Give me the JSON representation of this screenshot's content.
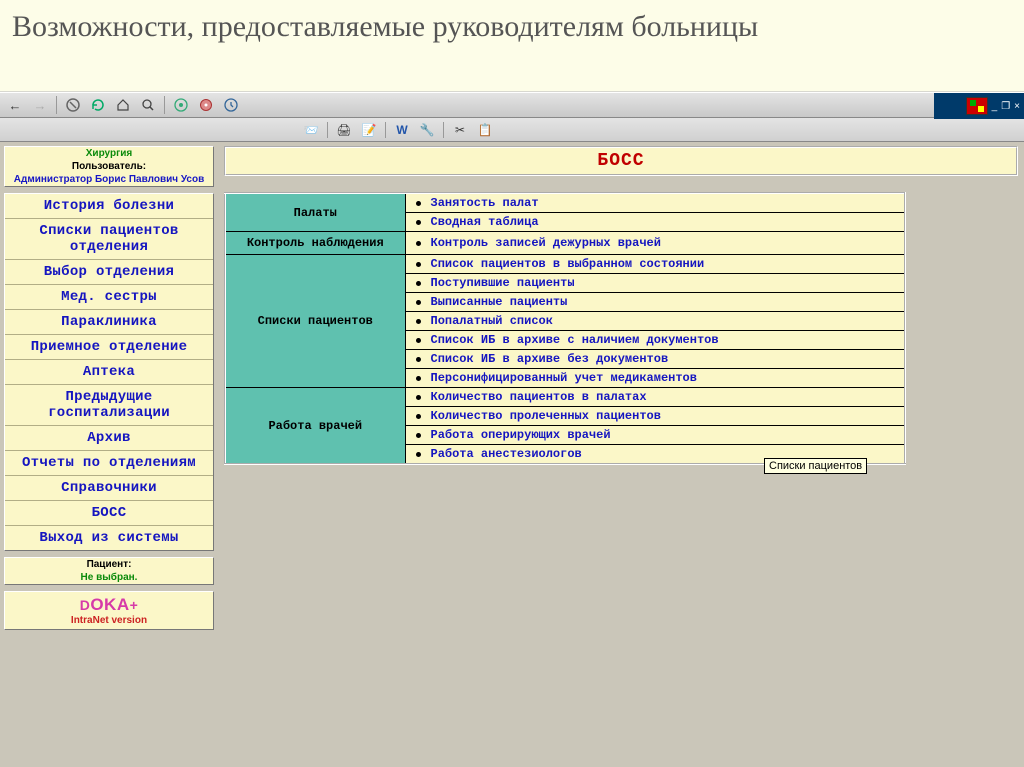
{
  "slide_title": "Возможности, предоставляемые руководителям больницы",
  "info_panel": {
    "department": "Хирургия",
    "user_label": "Пользователь:",
    "user_name": "Администратор Борис Павлович Усов"
  },
  "menu": [
    "История болезни",
    "Списки пациентов отделения",
    "Выбор отделения",
    "Мед. сестры",
    "Параклиника",
    "Приемное отделение",
    "Аптека",
    "Предыдущие госпитализации",
    "Архив",
    "Отчеты по отделениям",
    "Справочники",
    "БОСС",
    "Выход из системы"
  ],
  "patient_panel": {
    "label": "Пациент:",
    "value": "Не выбран."
  },
  "brand": {
    "line1_pre": "D",
    "line1_big1": "O",
    "line1_mid": "K",
    "line1_big2": "A",
    "line1_post": "+",
    "line2": "IntraNet version"
  },
  "main_title": "БОСС",
  "categories": [
    {
      "name": "Палаты",
      "options": [
        "Занятость палат",
        "Сводная таблица"
      ]
    },
    {
      "name": "Контроль наблюдения",
      "options": [
        "Контроль записей дежурных врачей"
      ]
    },
    {
      "name": "Списки пациентов",
      "options": [
        "Список пациентов в выбранном состоянии",
        "Поступившие пациенты",
        "Выписанные пациенты",
        "Попалатный список",
        "Список ИБ в архиве с наличием документов",
        "Список ИБ в архиве без документов",
        "Персонифицированный учет медикаментов"
      ]
    },
    {
      "name": "Работа врачей",
      "options": [
        "Количество пациентов в палатах",
        "Количество пролеченных пациентов",
        "Работа оперирующих врачей",
        "Работа анестезиологов"
      ]
    }
  ],
  "tooltip": "Списки пациентов",
  "window_controls": {
    "minimize": "_",
    "restore": "❐",
    "close": "×"
  }
}
